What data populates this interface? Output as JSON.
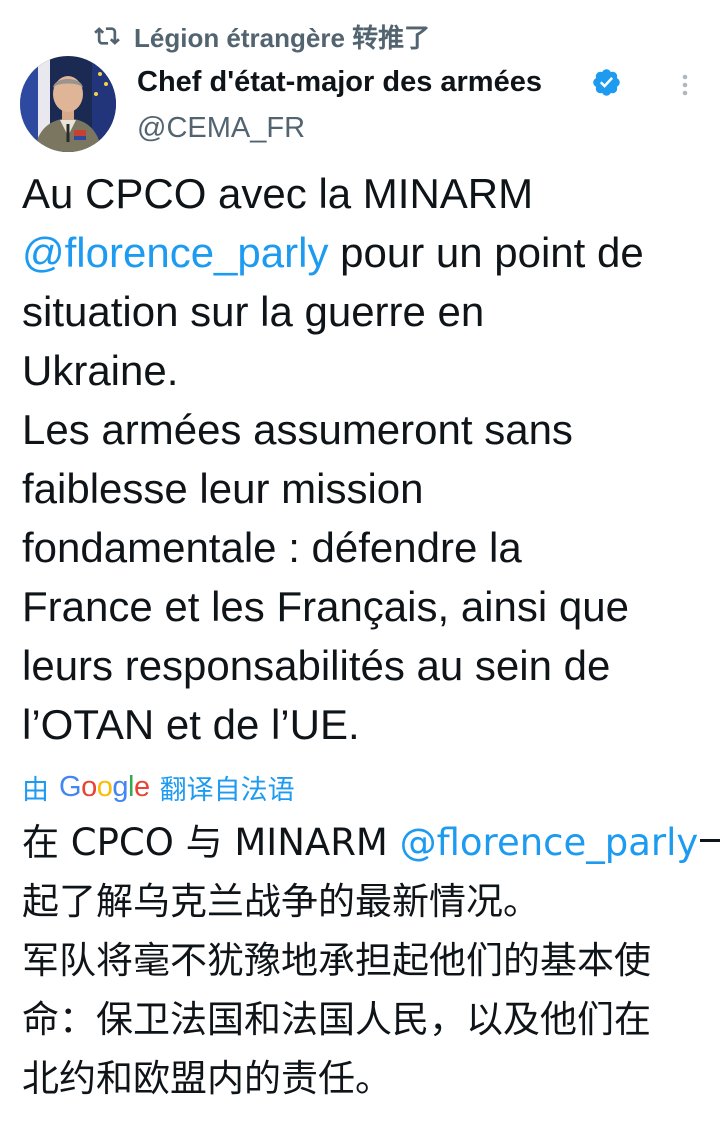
{
  "retweet": {
    "icon": "retweet-icon",
    "label": "Légion étrangère 转推了"
  },
  "author": {
    "avatar_icon": "avatar",
    "name": "Chef d'état-major des armées",
    "verified_icon": "verified-badge-icon",
    "handle": "@CEMA_FR"
  },
  "more_icon": "more-options-icon",
  "tweet": {
    "lines": [
      {
        "text": "Au CPCO avec la MINARM",
        "mention": "",
        "after": ""
      },
      {
        "text": "",
        "mention": "@florence_parly",
        "after": " pour un point de"
      },
      {
        "text": "situation sur la guerre en",
        "mention": "",
        "after": ""
      },
      {
        "text": "Ukraine.",
        "mention": "",
        "after": ""
      },
      {
        "text": "Les armées assumeront sans",
        "mention": "",
        "after": ""
      },
      {
        "text": "faiblesse leur mission",
        "mention": "",
        "after": ""
      },
      {
        "text": "fondamentale : défendre la",
        "mention": "",
        "after": ""
      },
      {
        "text": "France et les Français, ainsi que",
        "mention": "",
        "after": ""
      },
      {
        "text": "leurs responsabilités au sein de",
        "mention": "",
        "after": ""
      },
      {
        "text": "l’OTAN et de l’UE.",
        "mention": "",
        "after": ""
      }
    ]
  },
  "translation": {
    "prefix": "由",
    "google": [
      "G",
      "o",
      "o",
      "g",
      "l",
      "e"
    ],
    "suffix": "翻译自法语",
    "lines": [
      {
        "text": "在 CPCO 与 MINARM ",
        "mention": "@florence_parly",
        "after": "一"
      },
      {
        "text": "起了解乌克兰战争的最新情况。",
        "mention": "",
        "after": ""
      },
      {
        "text": "军队将毫不犹豫地承担起他们的基本使",
        "mention": "",
        "after": ""
      },
      {
        "text": "命：保卫法国和法国人民，以及他们在",
        "mention": "",
        "after": ""
      },
      {
        "text": "北约和欧盟内的责任。",
        "mention": "",
        "after": ""
      }
    ]
  },
  "colors": {
    "link": "#1d9bf0",
    "text": "#0f1419",
    "secondary": "#536471",
    "google": [
      "#4285F4",
      "#EA4335",
      "#FBBC05",
      "#4285F4",
      "#34A853",
      "#EA4335"
    ]
  }
}
